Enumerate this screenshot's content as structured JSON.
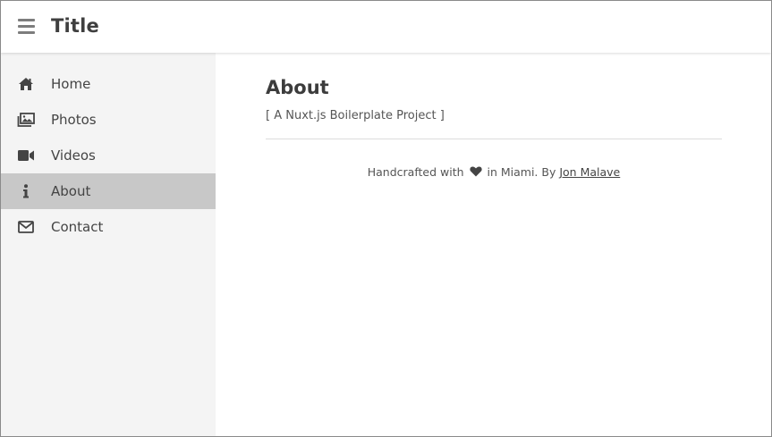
{
  "header": {
    "title": "Title",
    "menu_icon": "hamburger-menu-icon"
  },
  "sidebar": {
    "items": [
      {
        "label": "Home",
        "icon": "home-icon",
        "active": false
      },
      {
        "label": "Photos",
        "icon": "photos-icon",
        "active": false
      },
      {
        "label": "Videos",
        "icon": "video-camera-icon",
        "active": false
      },
      {
        "label": "About",
        "icon": "info-icon",
        "active": true
      },
      {
        "label": "Contact",
        "icon": "envelope-icon",
        "active": false
      }
    ]
  },
  "main": {
    "heading": "About",
    "subtitle": "[ A Nuxt.js Boilerplate Project ]",
    "footer": {
      "prefix": "Handcrafted with",
      "heart_icon": "heart-icon",
      "middle": "in Miami. By",
      "author": "Jon Malave"
    }
  },
  "colors": {
    "sidebar_bg": "#f4f4f4",
    "active_item_bg": "#c8c8c8",
    "text": "#444444",
    "icon": "#444444"
  }
}
